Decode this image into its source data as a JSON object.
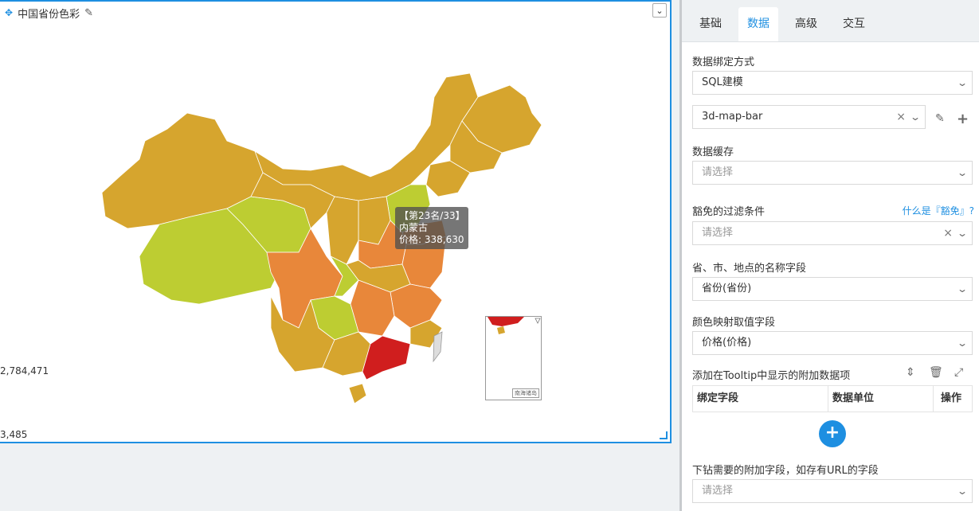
{
  "widget": {
    "title": "中国省份色彩",
    "legend_max": "2,784,471",
    "legend_min": "3,485",
    "tooltip": {
      "rank": "【第23名/33】",
      "province": "内蒙古",
      "price": "价格: 338,630"
    },
    "inset_label": "南海诸岛"
  },
  "colors": {
    "accent": "#1e8fe1",
    "low": "#bdcd32",
    "mid": "#d6a52e",
    "high": "#e8873a",
    "max": "#d01e1e"
  },
  "tabs": [
    {
      "label": "基础"
    },
    {
      "label": "数据"
    },
    {
      "label": "高级"
    },
    {
      "label": "交互"
    }
  ],
  "form": {
    "binding_label": "数据绑定方式",
    "binding_value": "SQL建模",
    "dataset_value": "3d-map-bar",
    "cache_label": "数据缓存",
    "cache_placeholder": "请选择",
    "filter_label": "豁免的过滤条件",
    "filter_help": "什么是『豁免』?",
    "filter_placeholder": "请选择",
    "name_field_label": "省、市、地点的名称字段",
    "name_field_value": "省份(省份)",
    "color_field_label": "颜色映射取值字段",
    "color_field_value": "价格(价格)",
    "tooltip_label": "添加在Tooltip中显示的附加数据项",
    "table_headers": [
      "绑定字段",
      "数据单位",
      "操作"
    ],
    "drill_label": "下钻需要的附加字段，如存有URL的字段",
    "drill_placeholder": "请选择"
  }
}
